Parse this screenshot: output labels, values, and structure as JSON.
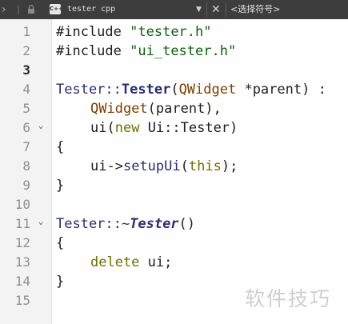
{
  "toolbar": {
    "forward_icon": "chevron-right-icon",
    "separator": "|",
    "lock_icon": "lock-icon",
    "file_type_label": "C++",
    "file_name": "tester cpp",
    "dropdown_glyph": "▼",
    "close_glyph": "✕",
    "symbol_selector": "<选择符号>"
  },
  "editor": {
    "current_line": 3,
    "lines": [
      {
        "num": "1"
      },
      {
        "num": "2"
      },
      {
        "num": "3"
      },
      {
        "num": "4"
      },
      {
        "num": "5"
      },
      {
        "num": "6",
        "fold": "⌄"
      },
      {
        "num": "7"
      },
      {
        "num": "8"
      },
      {
        "num": "9"
      },
      {
        "num": "10"
      },
      {
        "num": "11",
        "fold": "⌄"
      },
      {
        "num": "12"
      },
      {
        "num": "13"
      },
      {
        "num": "14"
      },
      {
        "num": "15"
      }
    ],
    "code": {
      "l1": {
        "directive": "#include",
        "arg": "\"tester.h\""
      },
      "l2": {
        "directive": "#include",
        "arg": "\"ui_tester.h\""
      },
      "l4": {
        "scope": "Tester::",
        "ctor": "Tester",
        "open": "(",
        "type": "QWidget",
        "param": " *parent) :"
      },
      "l5": {
        "base": "QWidget",
        "rest": "(parent),"
      },
      "l6": {
        "member": "ui",
        "open": "(",
        "kw": "new",
        "rest": " Ui::Tester)"
      },
      "l7": {
        "text": "{"
      },
      "l8": {
        "obj": "ui",
        "arrow": "->",
        "call": "setupUi",
        "open": "(",
        "kw": "this",
        "close": ");"
      },
      "l9": {
        "text": "}"
      },
      "l11": {
        "scope": "Tester::~",
        "dtor": "Tester",
        "rest": "()"
      },
      "l12": {
        "text": "{"
      },
      "l13": {
        "kw": "delete",
        "rest": " ui;"
      },
      "l14": {
        "text": "}"
      }
    }
  },
  "watermark": "软件技巧",
  "colors": {
    "toolbar_bg": "#3d3d3d",
    "gutter_bg": "#f3f3f3",
    "editor_bg": "#fefefe",
    "string": "#0f5f0f",
    "type": "#7b3f00",
    "keyword": "#6f6f00",
    "function": "#2d2d6e"
  }
}
